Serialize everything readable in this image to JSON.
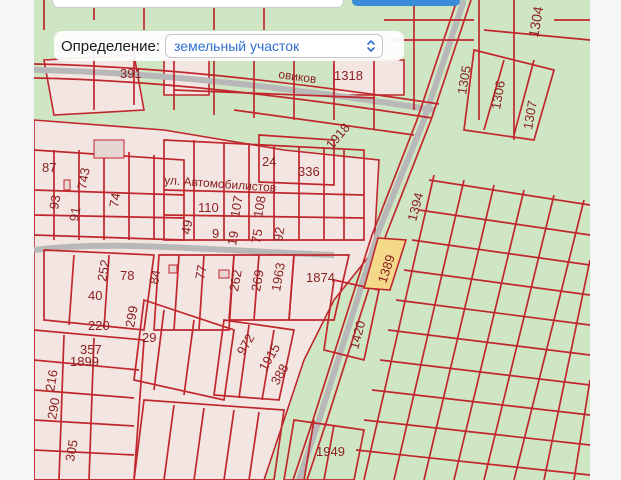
{
  "definition": {
    "label": "Определение:",
    "value": "земельный участок"
  },
  "icons": {
    "select": "chevron-up-down-icon"
  },
  "colors": {
    "parcel_line": "#c0272d",
    "parcel_fill": "#f4e8e6",
    "background": "#cfe6c4",
    "highlight_fill": "#f5d98a",
    "road": "#bdbdbd",
    "select_text": "#2f6fd3"
  },
  "map": {
    "parcels": [
      "1304",
      "391",
      "1318",
      "1305",
      "1306",
      "1307",
      "1918",
      "24",
      "336",
      "1394",
      "87",
      "743",
      "93",
      "74",
      "110",
      "107",
      "108",
      "91",
      "49",
      "9",
      "19",
      "75",
      "92",
      "1389",
      "252",
      "78",
      "84",
      "77",
      "262",
      "269",
      "1963",
      "1874",
      "40",
      "220",
      "299",
      "1420",
      "357",
      "29",
      "972",
      "1915",
      "388",
      "1899",
      "216",
      "290",
      "305",
      "1949"
    ],
    "streets": [
      "ул. Автомобилистов",
      "овиков"
    ]
  }
}
